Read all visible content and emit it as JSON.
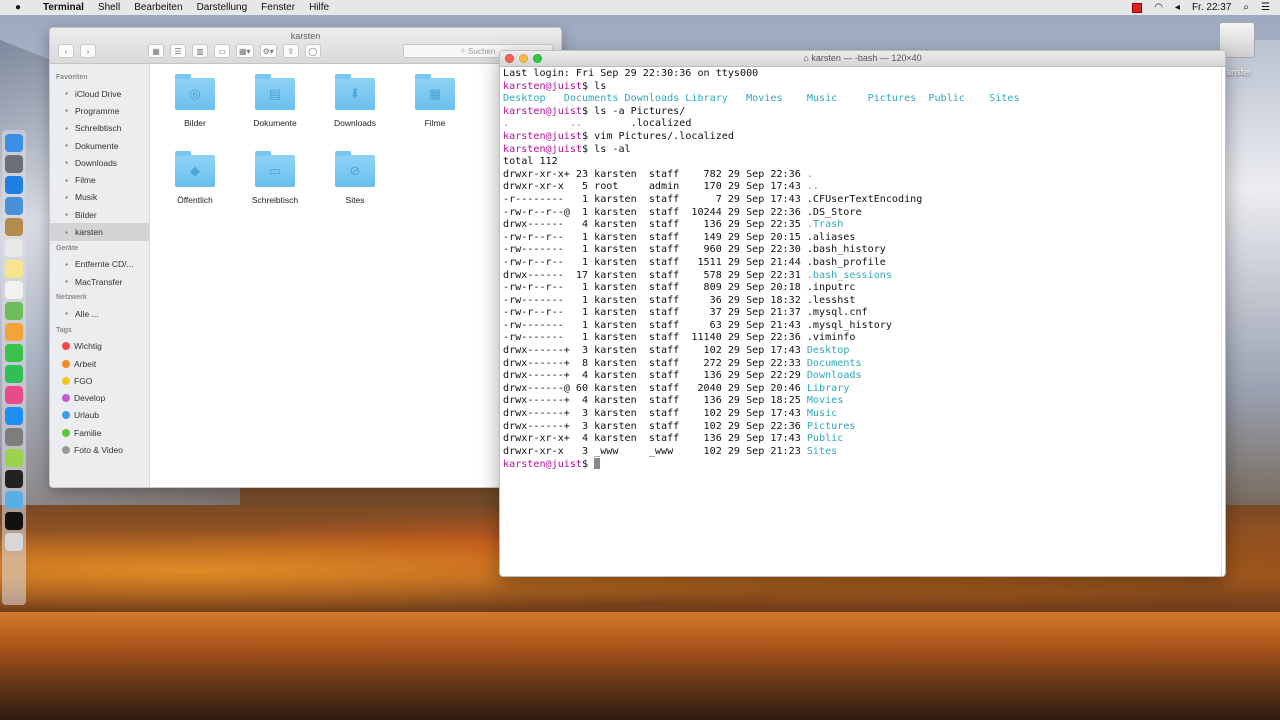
{
  "menubar": {
    "apple": "",
    "items": [
      "Terminal",
      "Shell",
      "Bearbeiten",
      "Darstellung",
      "Fenster",
      "Hilfe"
    ],
    "clock": "Fr. 22:37"
  },
  "desktop": {
    "drive_label": "Transfer"
  },
  "finder": {
    "title": "karsten",
    "search_placeholder": "Suchen",
    "sidebar": {
      "favorites_head": "Favoriten",
      "favorites": [
        {
          "label": "iCloud Drive",
          "icon": "cloud-icon"
        },
        {
          "label": "Programme",
          "icon": "apps-icon"
        },
        {
          "label": "Schreibtisch",
          "icon": "desktop-icon"
        },
        {
          "label": "Dokumente",
          "icon": "document-icon"
        },
        {
          "label": "Downloads",
          "icon": "download-icon"
        },
        {
          "label": "Filme",
          "icon": "film-icon"
        },
        {
          "label": "Musik",
          "icon": "music-icon"
        },
        {
          "label": "Bilder",
          "icon": "camera-icon"
        },
        {
          "label": "karsten",
          "icon": "home-icon"
        }
      ],
      "devices_head": "Geräte",
      "devices": [
        {
          "label": "Entfernte CD/...",
          "icon": "disc-icon"
        },
        {
          "label": "MacTransfer",
          "icon": "drive-icon"
        }
      ],
      "network_head": "Netzwerk",
      "network": [
        {
          "label": "Alle ...",
          "icon": "network-icon"
        }
      ],
      "tags_head": "Tags",
      "tags": [
        {
          "label": "Wichtig",
          "color": "#f04848"
        },
        {
          "label": "Arbeit",
          "color": "#f28a2a"
        },
        {
          "label": "FGO",
          "color": "#f5c623"
        },
        {
          "label": "Develop",
          "color": "#c25ad0"
        },
        {
          "label": "Urlaub",
          "color": "#3ba0e6"
        },
        {
          "label": "Familie",
          "color": "#5cc83b"
        },
        {
          "label": "Foto & Video",
          "color": "#9a9a9a"
        }
      ]
    },
    "folders": [
      {
        "label": "Bilder",
        "glyph": "◎",
        "icon": "camera-folder-icon"
      },
      {
        "label": "Dokumente",
        "glyph": "▤",
        "icon": "document-folder-icon"
      },
      {
        "label": "Downloads",
        "glyph": "⬇",
        "icon": "download-folder-icon"
      },
      {
        "label": "Filme",
        "glyph": "▦",
        "icon": "film-folder-icon"
      },
      {
        "label": "Öffentlich",
        "glyph": "◆",
        "icon": "public-folder-icon"
      },
      {
        "label": "Schreibtisch",
        "glyph": "▭",
        "icon": "desktop-folder-icon"
      },
      {
        "label": "Sites",
        "glyph": "⊘",
        "icon": "sites-folder-icon"
      }
    ]
  },
  "terminal": {
    "title": "karsten — -bash — 120×40",
    "lines": [
      [
        {
          "t": "Last login: Fri Sep 29 22:30:36 on ttys000"
        }
      ],
      [
        {
          "t": "karsten@juist",
          "c": "prompt"
        },
        {
          "t": "$ ls"
        }
      ],
      [
        {
          "t": "Desktop   Documents Downloads Library   Movies    Music     Pictures  Public    Sites",
          "c": "dir"
        }
      ],
      [
        {
          "t": "karsten@juist",
          "c": "prompt"
        },
        {
          "t": "$ ls -a Pictures/"
        }
      ],
      [
        {
          "t": ".          ..",
          "c": "dir"
        },
        {
          "t": "        .localized"
        }
      ],
      [
        {
          "t": "karsten@juist",
          "c": "prompt"
        },
        {
          "t": "$ vim Pictures/.localized"
        }
      ],
      [
        {
          "t": "karsten@juist",
          "c": "prompt"
        },
        {
          "t": "$ ls -al"
        }
      ],
      [
        {
          "t": "total 112"
        }
      ],
      [
        {
          "t": "drwxr-xr-x+ 23 karsten  staff    782 29 Sep 22:36 "
        },
        {
          "t": ".",
          "c": "dir"
        }
      ],
      [
        {
          "t": "drwxr-xr-x   5 root     admin    170 29 Sep 17:43 "
        },
        {
          "t": "..",
          "c": "dir"
        }
      ],
      [
        {
          "t": "-r--------   1 karsten  staff      7 29 Sep 17:43 .CFUserTextEncoding"
        }
      ],
      [
        {
          "t": "-rw-r--r--@  1 karsten  staff  10244 29 Sep 22:36 .DS_Store"
        }
      ],
      [
        {
          "t": "drwx------   4 karsten  staff    136 29 Sep 22:35 "
        },
        {
          "t": ".Trash",
          "c": "dir"
        }
      ],
      [
        {
          "t": "-rw-r--r--   1 karsten  staff    149 29 Sep 20:15 .aliases"
        }
      ],
      [
        {
          "t": "-rw-------   1 karsten  staff    960 29 Sep 22:30 .bash_history"
        }
      ],
      [
        {
          "t": "-rw-r--r--   1 karsten  staff   1511 29 Sep 21:44 .bash_profile"
        }
      ],
      [
        {
          "t": "drwx------  17 karsten  staff    578 29 Sep 22:31 "
        },
        {
          "t": ".bash_sessions",
          "c": "dir"
        }
      ],
      [
        {
          "t": "-rw-r--r--   1 karsten  staff    809 29 Sep 20:18 .inputrc"
        }
      ],
      [
        {
          "t": "-rw-------   1 karsten  staff     36 29 Sep 18:32 .lesshst"
        }
      ],
      [
        {
          "t": "-rw-r--r--   1 karsten  staff     37 29 Sep 21:37 .mysql.cnf"
        }
      ],
      [
        {
          "t": "-rw-------   1 karsten  staff     63 29 Sep 21:43 .mysql_history"
        }
      ],
      [
        {
          "t": "-rw-------   1 karsten  staff  11140 29 Sep 22:36 .viminfo"
        }
      ],
      [
        {
          "t": "drwx------+  3 karsten  staff    102 29 Sep 17:43 "
        },
        {
          "t": "Desktop",
          "c": "dir"
        }
      ],
      [
        {
          "t": "drwx------+  8 karsten  staff    272 29 Sep 22:33 "
        },
        {
          "t": "Documents",
          "c": "dir"
        }
      ],
      [
        {
          "t": "drwx------+  4 karsten  staff    136 29 Sep 22:29 "
        },
        {
          "t": "Downloads",
          "c": "dir"
        }
      ],
      [
        {
          "t": "drwx------@ 60 karsten  staff   2040 29 Sep 20:46 "
        },
        {
          "t": "Library",
          "c": "dir"
        }
      ],
      [
        {
          "t": "drwx------+  4 karsten  staff    136 29 Sep 18:25 "
        },
        {
          "t": "Movies",
          "c": "dir"
        }
      ],
      [
        {
          "t": "drwx------+  3 karsten  staff    102 29 Sep 17:43 "
        },
        {
          "t": "Music",
          "c": "dir"
        }
      ],
      [
        {
          "t": "drwx------+  3 karsten  staff    102 29 Sep 22:36 "
        },
        {
          "t": "Pictures",
          "c": "dir"
        }
      ],
      [
        {
          "t": "drwxr-xr-x+  4 karsten  staff    136 29 Sep 17:43 "
        },
        {
          "t": "Public",
          "c": "dir"
        }
      ],
      [
        {
          "t": "drwxr-xr-x   3 _www     _www     102 29 Sep 21:23 "
        },
        {
          "t": "Sites",
          "c": "dir"
        }
      ],
      [
        {
          "t": "karsten@juist",
          "c": "prompt"
        },
        {
          "t": "$ "
        }
      ]
    ]
  },
  "dock": {
    "icons": [
      {
        "name": "finder-icon",
        "color": "#3a8ee6"
      },
      {
        "name": "launchpad-icon",
        "color": "#6c6f77"
      },
      {
        "name": "safari-icon",
        "color": "#1f7fe0"
      },
      {
        "name": "mail-icon",
        "color": "#4a90d9"
      },
      {
        "name": "contacts-icon",
        "color": "#b48a4f"
      },
      {
        "name": "calendar-icon",
        "color": "#e9e9e9"
      },
      {
        "name": "notes-icon",
        "color": "#f6e58d"
      },
      {
        "name": "reminders-icon",
        "color": "#f2f2f2"
      },
      {
        "name": "maps-icon",
        "color": "#6dbb5b"
      },
      {
        "name": "photos-icon",
        "color": "#f3a33a"
      },
      {
        "name": "messages-icon",
        "color": "#37c24b"
      },
      {
        "name": "facetime-icon",
        "color": "#2fbf55"
      },
      {
        "name": "itunes-icon",
        "color": "#e94a8a"
      },
      {
        "name": "appstore-icon",
        "color": "#1f8ef1"
      },
      {
        "name": "preferences-icon",
        "color": "#7d7d7d"
      },
      {
        "name": "sequel-icon",
        "color": "#9ad24e"
      },
      {
        "name": "terminal-icon",
        "color": "#222222"
      },
      {
        "name": "folder-icon",
        "color": "#5aaee6"
      },
      {
        "name": "terminal2-icon",
        "color": "#111111"
      },
      {
        "name": "trash-icon",
        "color": "#d7d7d7"
      }
    ]
  }
}
